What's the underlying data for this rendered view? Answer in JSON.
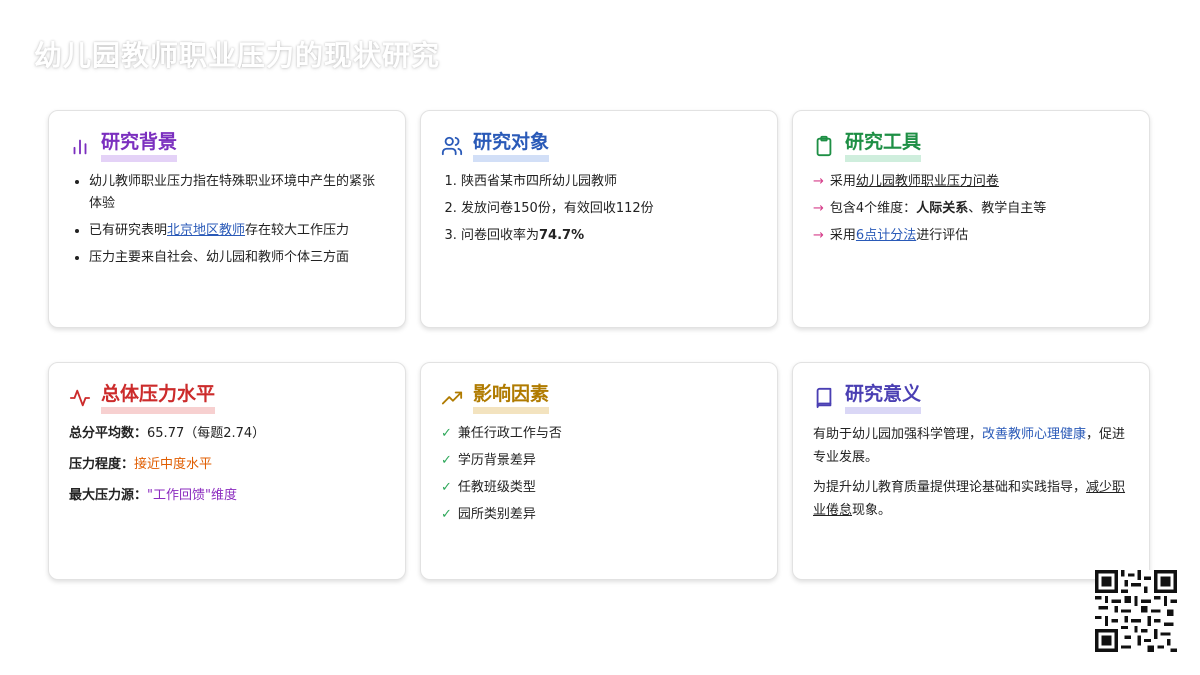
{
  "title": "幼儿园教师职业压力的现状研究",
  "cards": {
    "background": {
      "title": "研究背景",
      "items": [
        "幼儿教师职业压力指在特殊职业环境中产生的紧张体验",
        {
          "pre": "已有研究表明",
          "link": "北京地区教师",
          "post": "存在较大工作压力"
        },
        "压力主要来自社会、幼儿园和教师个体三方面"
      ]
    },
    "subjects": {
      "title": "研究对象",
      "items": [
        "陕西省某市四所幼儿园教师",
        "发放问卷150份，有效回收112份",
        {
          "pre": "问卷回收率为",
          "bold": "74.7%"
        }
      ]
    },
    "tools": {
      "title": "研究工具",
      "items": [
        {
          "pre": "采用",
          "uline": "幼儿园教师职业压力问卷"
        },
        {
          "pre": "包含4个维度：",
          "bold": "人际关系",
          "post": "、教学自主等"
        },
        {
          "pre": "采用",
          "link": "6点计分法",
          "post": "进行评估"
        }
      ]
    },
    "overall": {
      "title": "总体压力水平",
      "stats": [
        {
          "label": "总分平均数：",
          "value": "65.77（每题2.74）"
        },
        {
          "label": "压力程度：",
          "value": "接近中度水平"
        },
        {
          "label": "最大压力源：",
          "value": "\"工作回馈\"维度"
        }
      ]
    },
    "factors": {
      "title": "影响因素",
      "items": [
        "兼任行政工作与否",
        "学历背景差异",
        "任教班级类型",
        "园所类别差异"
      ]
    },
    "significance": {
      "title": "研究意义",
      "p1_pre": "有助于幼儿园加强科学管理，",
      "p1_link": "改善教师心理健康",
      "p1_post": "，促进专业发展。",
      "p2_pre": "为提升幼儿教育质量提供理论基础和实践指导，",
      "p2_uline": "减少职业倦怠",
      "p2_post": "现象。"
    }
  },
  "icons": {
    "background": "bar-chart-icon",
    "subjects": "users-icon",
    "tools": "clipboard-icon",
    "overall": "activity-icon",
    "factors": "trending-up-icon",
    "significance": "book-icon",
    "bullet_arrow": "arrow-right-icon",
    "bullet_check": "check-icon"
  },
  "glyphs": {
    "arrow": "→",
    "check": "✓"
  },
  "colors": {
    "purple": "#7b2fbf",
    "blue": "#2a5ab8",
    "green": "#1e8f45",
    "red": "#cc2b2b",
    "gold": "#b07b00",
    "indigo": "#4a3fb3",
    "pink_arrow": "#d63d8a",
    "orange": "#e05d00"
  }
}
